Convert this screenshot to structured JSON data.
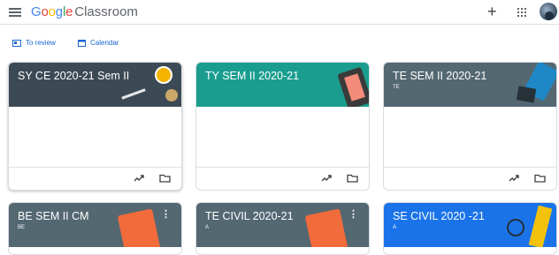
{
  "app": {
    "brand_google": "Google",
    "brand_product": "Classroom"
  },
  "topbar": {
    "icons": [
      "menu-icon",
      "plus-icon",
      "apps-grid-icon",
      "avatar"
    ]
  },
  "links": {
    "to_review": "To review",
    "calendar": "Calendar"
  },
  "colors": {
    "dark_slate": "#3c4a55",
    "teal": "#1a9d8f",
    "slate_gray": "#546872",
    "blue": "#1a73e8",
    "link_blue": "#1967d2"
  },
  "cards": [
    {
      "title": "SY CE 2020-21 Sem II",
      "subtitle": "",
      "theme": "dark_slate"
    },
    {
      "title": "TY SEM II 2020-21",
      "subtitle": "",
      "theme": "teal"
    },
    {
      "title": "TE SEM II 2020-21",
      "subtitle": "TE",
      "theme": "slate_gray"
    },
    {
      "title": "BE SEM II CM",
      "subtitle": "BE",
      "theme": "slate_gray"
    },
    {
      "title": "TE CIVIL 2020-21",
      "subtitle": "A",
      "theme": "slate_gray"
    },
    {
      "title": "SE CIVIL 2020 -21",
      "subtitle": "A",
      "theme": "blue"
    }
  ]
}
